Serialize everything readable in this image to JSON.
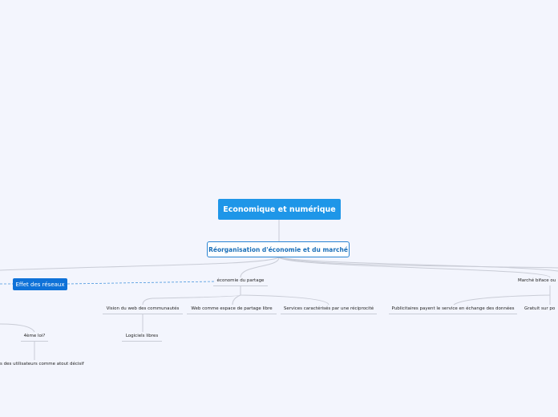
{
  "map": {
    "root": "Economique et numérique",
    "main": "Réorganisation d'économie et du marché",
    "effet_reseaux": "Effet des réseaux",
    "economie_partage": "économie du partage",
    "vision_web": "Vision du web des communautés",
    "logiciels_libres": "Logiciels libres",
    "web_partage": "Web comme espace de partage libre",
    "services_reciprocite": "Services caractérisés par une réciprocité",
    "marche_biface": "Marché biface ou",
    "publicitaires": "Publicitaires payent le service en échange des données",
    "gratuit": "Gratuit sur po",
    "quatrieme_loi": "4ème loi?",
    "utilisateurs_atout": "s des utilisateurs comme atout décisif"
  },
  "colors": {
    "background": "#f3f5fd",
    "root_fill": "#1e96e8",
    "main_border": "#2a84d2",
    "badge_fill": "#0f72d8",
    "connector": "#c9ccd6",
    "dashed_link": "#4a97de"
  }
}
